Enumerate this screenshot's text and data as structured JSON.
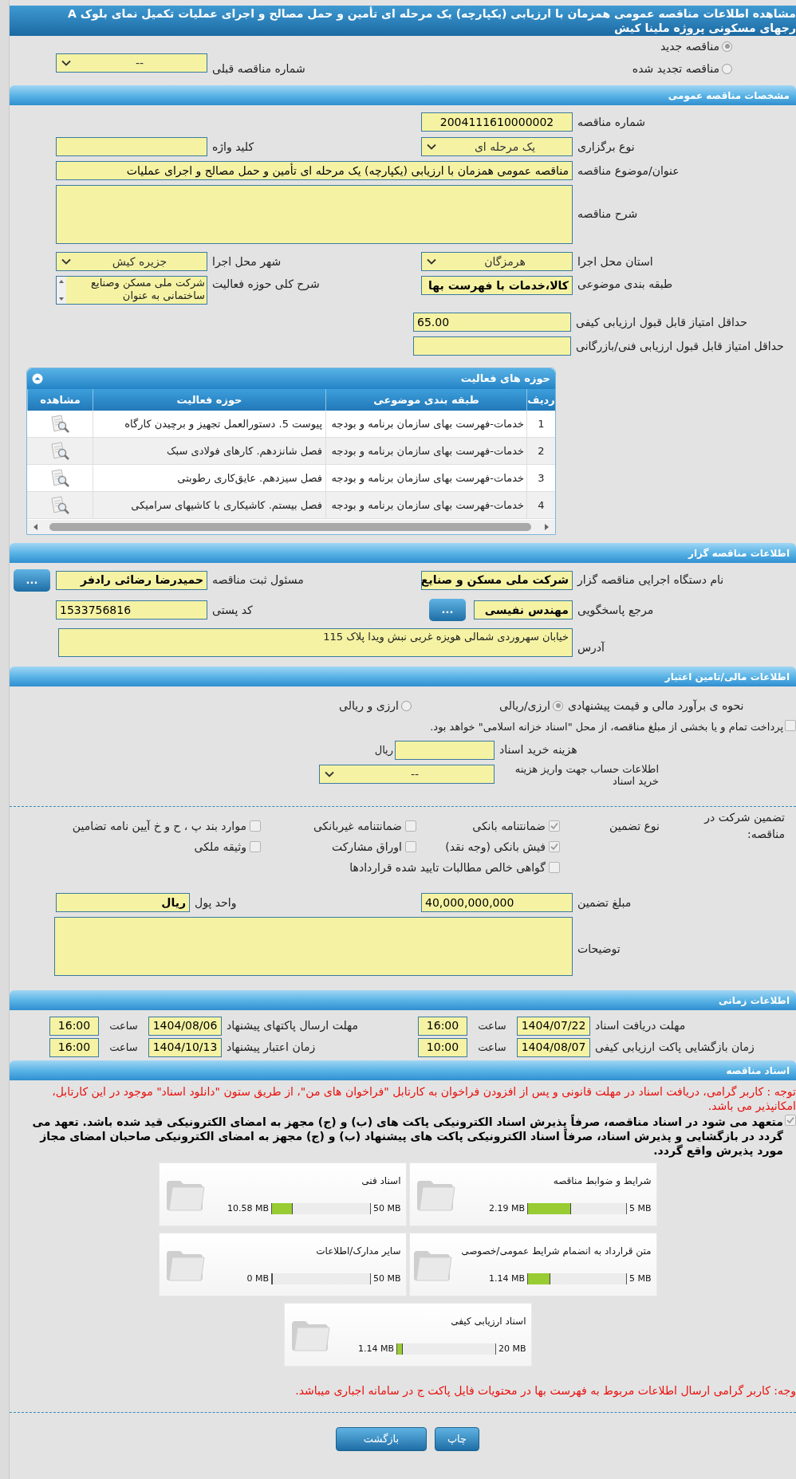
{
  "title_lines": [
    "مشاهده اطلاعات مناقصه عمومی همزمان با ارزیابی (یکپارچه) یک مرحله ای تأمین و حمل مصالح و اجرای عملیات تکمیل نمای بلوک A",
    "رجهای مسکونی پروژه ملینا کیش"
  ],
  "tender_kind": [
    {
      "label": "مناقصه جدید",
      "selected": true
    },
    {
      "label": "مناقصه تجدید شده",
      "selected": false
    }
  ],
  "previous_tender": {
    "label": "شماره مناقصه قبلی",
    "value": "--"
  },
  "general": {
    "title": "مشخصات مناقصه عمومی",
    "tender_number": {
      "label": "شماره مناقصه",
      "value": "2004111610000002"
    },
    "holding_type": {
      "label": "نوع برگزاری",
      "value": "یک مرحله ای"
    },
    "keyword": {
      "label": "کلید واژه"
    },
    "subject": {
      "label": "عنوان/موضوع مناقصه",
      "value": "مناقصه عمومی همزمان با ارزیابی (یکپارچه) یک مرحله ای تأمین و حمل مصالح و اجرای عملیات"
    },
    "description": {
      "label": "شرح مناقصه"
    },
    "province": {
      "label": "استان محل اجرا",
      "value": "هرمزگان"
    },
    "city": {
      "label": "شهر محل اجرا",
      "value": "جزیره کیش"
    },
    "category": {
      "label": "طبقه بندی موضوعی",
      "value": "کالا،خدمات با فهرست بها"
    },
    "activity_scope": {
      "label": "شرح کلی حوزه فعالیت",
      "lines": [
        "شرکت ملی مسکن وصنایع",
        "ساختمانی به عنوان"
      ]
    },
    "min_quality_score": {
      "label": "حداقل امتیاز قابل قبول ارزیابی کیفی",
      "value": "65.00"
    },
    "min_technical_score": {
      "label": "حداقل امتیاز قابل قبول ارزیابی فنی/بازرگانی"
    }
  },
  "activities": {
    "title": "حوزه های فعالیت",
    "columns": [
      "ردیف",
      "طبقه بندی موضوعی",
      "حوزه فعالیت",
      "مشاهده"
    ],
    "rows": [
      {
        "number": "1",
        "category": "خدمات-فهرست بهای سازمان برنامه و بودجه",
        "activity": "پیوست 5. دستورالعمل تجهیز و برچیدن کارگاه"
      },
      {
        "number": "2",
        "category": "خدمات-فهرست بهای سازمان برنامه و بودجه",
        "activity": "فصل شانزدهم. کارهای فولادی سبک"
      },
      {
        "number": "3",
        "category": "خدمات-فهرست بهای سازمان برنامه و بودجه",
        "activity": "فصل سیزدهم. عایق‌کاری رطوبتی"
      },
      {
        "number": "4",
        "category": "خدمات-فهرست بهای سازمان برنامه و بودجه",
        "activity": "فصل بیستم. کاشیکاری با کاشیهای سرامیکی"
      }
    ]
  },
  "organizer": {
    "title": "اطلاعات مناقصه گزار",
    "org_name": {
      "label": "نام دستگاه اجرایی مناقصه گزار",
      "value": "شرکت ملی مسکن و صنایع"
    },
    "registrar": {
      "label": "مسئول ثبت مناقصه",
      "value": "حمیدرضا رضائی رادفر",
      "button": "..."
    },
    "responder": {
      "label": "مرجع پاسخگویی",
      "value": "مهندس نفیسی",
      "button": "..."
    },
    "postal_code": {
      "label": "کد پستی",
      "value": "1533756816"
    },
    "address": {
      "label": "آدرس",
      "value": "خیابان سهروردی شمالی هویزه غربی نبش ویدا پلاک 115"
    }
  },
  "finance": {
    "title": "اطلاعات مالی/تامین اعتبار",
    "estimate": {
      "label": "نحوه ی برآورد مالی و قیمت پیشنهادی",
      "options": [
        {
          "label": "ارزی/ریالی",
          "selected": true
        },
        {
          "label": "ارزی و ریالی",
          "selected": false
        }
      ]
    },
    "treasury": {
      "label": "پرداخت تمام و یا بخشی از مبلغ مناقصه، از محل \"اسناد خزانه اسلامی\" خواهد بود.",
      "checked": false
    },
    "doc_fee": {
      "label": "هزینه خرید اسناد",
      "unit": "ریال"
    },
    "account": {
      "label": "اطلاعات حساب جهت واریز هزینه خرید اسناد",
      "value": "--"
    }
  },
  "guarantee": {
    "label": "تضمین شرکت در مناقصه:",
    "type_label": "نوع تضمین",
    "options": [
      {
        "label": "ضمانتنامه بانکی",
        "checked": true
      },
      {
        "label": "ضمانتنامه غیربانکی",
        "checked": false
      },
      {
        "label": "موارد بند پ ، ح و خ آیین نامه تضامین",
        "checked": false
      },
      {
        "label": "فیش بانکی (وجه نقد)",
        "checked": true
      },
      {
        "label": "اوراق مشارکت",
        "checked": false
      },
      {
        "label": "وثیقه ملکی",
        "checked": false
      },
      {
        "label": "گواهی خالص مطالبات تایید شده قراردادها",
        "checked": false
      }
    ],
    "amount": {
      "label": "مبلغ تضمین",
      "value": "40,000,000,000"
    },
    "currency": {
      "label": "واحد پول",
      "value": "ریال"
    },
    "notes": {
      "label": "توضیحات"
    }
  },
  "timing": {
    "title": "اطلاعات زمانی",
    "items": [
      {
        "label": "مهلت دریافت اسناد",
        "date": "1404/07/22",
        "time_label": "ساعت",
        "time": "16:00"
      },
      {
        "label": "مهلت ارسال پاکتهای پیشنهاد",
        "date": "1404/08/06",
        "time_label": "ساعت",
        "time": "16:00"
      },
      {
        "label": "زمان بازگشایی پاکت ارزیابی کیفی",
        "date": "1404/08/07",
        "time_label": "ساعت",
        "time": "10:00"
      },
      {
        "label": "زمان اعتبار پیشنهاد",
        "date": "1404/10/13",
        "time_label": "ساعت",
        "time": "16:00"
      }
    ]
  },
  "documents": {
    "title": "اسناد مناقصه",
    "notice": "توجه : کاربر گرامی، دریافت اسناد در مهلت قانونی و پس از افزودن فراخوان به کارتابل \"فراخوان های من\"، از طریق ستون \"دانلود اسناد\" موجود در این کارتابل، امکانپذیر می باشد.",
    "commitment": {
      "text": "متعهد می شود در اسناد مناقصه، صرفاً پذیرش اسناد الکترونیکی پاکت های (ب) و (ج) مجهز به امضای الکترونیکی قید شده باشد. تعهد می گردد در بازگشایی و پذیرش اسناد، صرفاً اسناد الکترونیکی پاکت های پیشنهاد (ب) و (ج) مجهز به امضای الکترونیکی صاحبان امضای مجاز مورد پذیرش واقع گردد.",
      "checked": true
    },
    "files": [
      {
        "name": "شرایط و ضوابط مناقصه",
        "size": "2.19 MB",
        "max": "5 MB",
        "level": 0.438
      },
      {
        "name": "اسناد فنی",
        "size": "10.58 MB",
        "max": "50 MB",
        "level": 0.212
      },
      {
        "name": "متن قرارداد به انضمام شرایط عمومی/خصوصی",
        "size": "1.14 MB",
        "max": "5 MB",
        "level": 0.228
      },
      {
        "name": "سایر مدارک/اطلاعات",
        "size": "0 MB",
        "max": "50 MB",
        "level": 0
      },
      {
        "name": "اسناد ارزیابی کیفی",
        "size": "1.14 MB",
        "max": "20 MB",
        "level": 0.057
      }
    ],
    "footnote": "وجه: کاربر گرامی ارسال اطلاعات مربوط به فهرست بها در محتویات فایل پاکت ج در سامانه اجباری میباشد."
  },
  "buttons": [
    "چاپ",
    "بازگشت"
  ]
}
